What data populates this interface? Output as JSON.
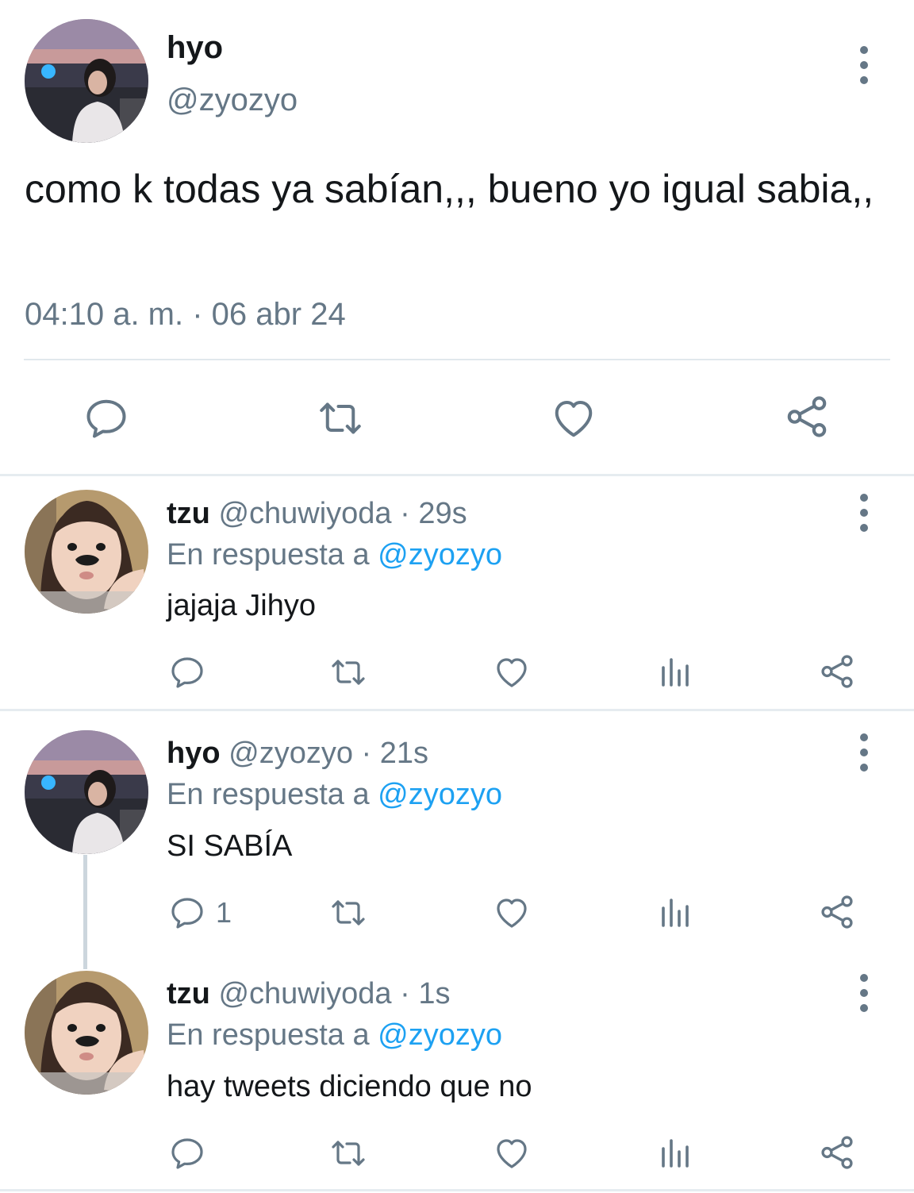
{
  "main_tweet": {
    "name": "hyo",
    "handle": "@zyozyo",
    "text": "como k todas ya sabían,,, bueno yo igual sabia,,",
    "timestamp": "04:10 a. m. · 06 abr 24",
    "actions": [
      "comment-icon",
      "retweet-icon",
      "heart-icon",
      "share-icon"
    ]
  },
  "replies": [
    {
      "name": "tzu",
      "handle": "@chuwiyoda",
      "dot": "·",
      "time": "29s",
      "reply_prefix": "En respuesta a",
      "reply_to": "@zyozyo",
      "text": "jajaja Jihyo",
      "comment_count": ""
    },
    {
      "name": "hyo",
      "handle": "@zyozyo",
      "dot": "·",
      "time": "21s",
      "reply_prefix": "En respuesta a",
      "reply_to": "@zyozyo",
      "text": "SI SABÍA",
      "comment_count": "1"
    },
    {
      "name": "tzu",
      "handle": "@chuwiyoda",
      "dot": "·",
      "time": "1s",
      "reply_prefix": "En respuesta a",
      "reply_to": "@zyozyo",
      "text": "hay tweets diciendo que no",
      "comment_count": ""
    }
  ],
  "colors": {
    "text": "#14171a",
    "secondary": "#657786",
    "link": "#1da1f2",
    "divider": "#e6ecf0"
  }
}
